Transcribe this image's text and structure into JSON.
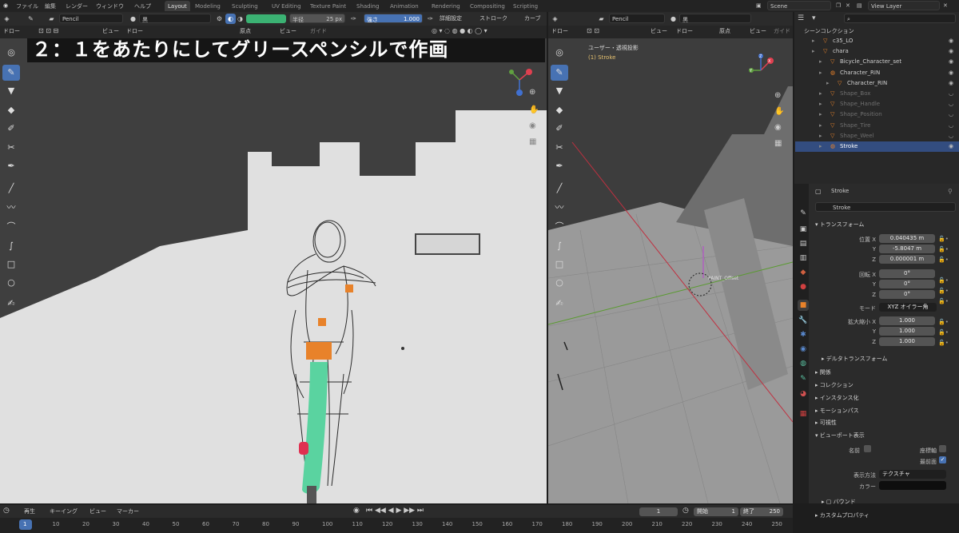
{
  "menu": {
    "file": "ファイル",
    "edit": "編集",
    "render": "レンダー",
    "window": "ウィンドウ",
    "help": "ヘルプ"
  },
  "workspaces": [
    "Layout",
    "Modeling",
    "Sculpting",
    "UV Editing",
    "Texture Paint",
    "Shading",
    "Animation",
    "Rendering",
    "Compositing",
    "Scripting"
  ],
  "scene": {
    "name": "Scene",
    "view_layer": "View Layer"
  },
  "left_header": {
    "brush": "Pencil",
    "material": "黒",
    "radius_label": "半径",
    "radius_value": "25 px",
    "strength_label": "強さ",
    "strength_value": "1.000",
    "advanced": "詳細設定",
    "stroke": "ストローク",
    "curve": "カーブ"
  },
  "left_header2": {
    "mode": "ドロー",
    "view": "ビュー",
    "draw": "ドロー",
    "origin": "原点",
    "view2": "ビュー",
    "guide": "ガイド"
  },
  "right_header": {
    "brush": "Pencil",
    "material": "黒"
  },
  "right_header2": {
    "mode": "ドロー",
    "view": "ビュー",
    "draw": "ドロー",
    "origin": "原点",
    "view2": "ビュー",
    "guide": "ガイド"
  },
  "caption": "２：１をあたりにしてグリースペンシルで作画",
  "right_viewport": {
    "view_name": "ユーザー・透視投影",
    "object_label": "(1) Stroke",
    "empty_label": "PAINT_Offset"
  },
  "gizmo": {
    "x": "X",
    "y": "Y",
    "z": "Z"
  },
  "outliner": {
    "title": "シーンコレクション",
    "rows": [
      {
        "label": "c35_LO",
        "indent": 1,
        "dim": false,
        "sel": false
      },
      {
        "label": "chara",
        "indent": 1,
        "dim": false,
        "sel": false
      },
      {
        "label": "Bicycle_Character_set",
        "indent": 2,
        "dim": false,
        "sel": false
      },
      {
        "label": "Character_RIN",
        "indent": 2,
        "dim": false,
        "sel": false
      },
      {
        "label": "Character_RIN",
        "indent": 3,
        "dim": false,
        "sel": false
      },
      {
        "label": "Shape_Box",
        "indent": 2,
        "dim": true,
        "sel": false
      },
      {
        "label": "Shape_Handle",
        "indent": 2,
        "dim": true,
        "sel": false
      },
      {
        "label": "Shape_Position",
        "indent": 2,
        "dim": true,
        "sel": false
      },
      {
        "label": "Shape_Tire",
        "indent": 2,
        "dim": true,
        "sel": false
      },
      {
        "label": "Shape_Weel",
        "indent": 2,
        "dim": true,
        "sel": false
      },
      {
        "label": "Stroke",
        "indent": 2,
        "dim": false,
        "sel": true
      }
    ]
  },
  "props": {
    "object_name": "Stroke",
    "object_name_field": "Stroke",
    "transform": "トランスフォーム",
    "location_label": "位置 X",
    "loc_x": "0.040435 m",
    "loc_y": "-5.8047 m",
    "loc_z": "0.000001 m",
    "rotation_label": "回転 X",
    "rot_x": "0°",
    "rot_y": "0°",
    "rot_z": "0°",
    "mode_label": "モード",
    "mode_value": "XYZ オイラー角",
    "scale_label": "拡大縮小 X",
    "scale_x": "1.000",
    "scale_y": "1.000",
    "scale_z": "1.000",
    "y_label": "Y",
    "z_label": "Z",
    "delta": "デルタトランスフォーム",
    "relations": "関係",
    "collection": "コレクション",
    "instancing": "インスタンス化",
    "motion_path": "モーションパス",
    "visibility": "可視性",
    "viewport_display": "ビューポート表示",
    "name_label": "名前",
    "axes_label": "座標軸",
    "in_front_label": "最前面",
    "display_as_label": "表示方法",
    "display_as_value": "テクスチャ",
    "color_label": "カラー",
    "bounds_label": "バウンド",
    "custom_props": "カスタムプロパティ"
  },
  "timeline": {
    "playback": "再生",
    "keying": "キーイング",
    "view": "ビュー",
    "marker": "マーカー",
    "current_frame": "1",
    "start_label": "開始",
    "start": "1",
    "end_label": "終了",
    "end": "250",
    "ticks": [
      "1",
      "10",
      "20",
      "30",
      "40",
      "50",
      "60",
      "70",
      "80",
      "90",
      "100",
      "110",
      "120",
      "130",
      "140",
      "150",
      "160",
      "170",
      "180",
      "190",
      "200",
      "210",
      "220",
      "230",
      "240",
      "250"
    ]
  },
  "colors": {
    "accent": "#4772b3",
    "green": "#3bb273",
    "orange": "#e8822a"
  }
}
